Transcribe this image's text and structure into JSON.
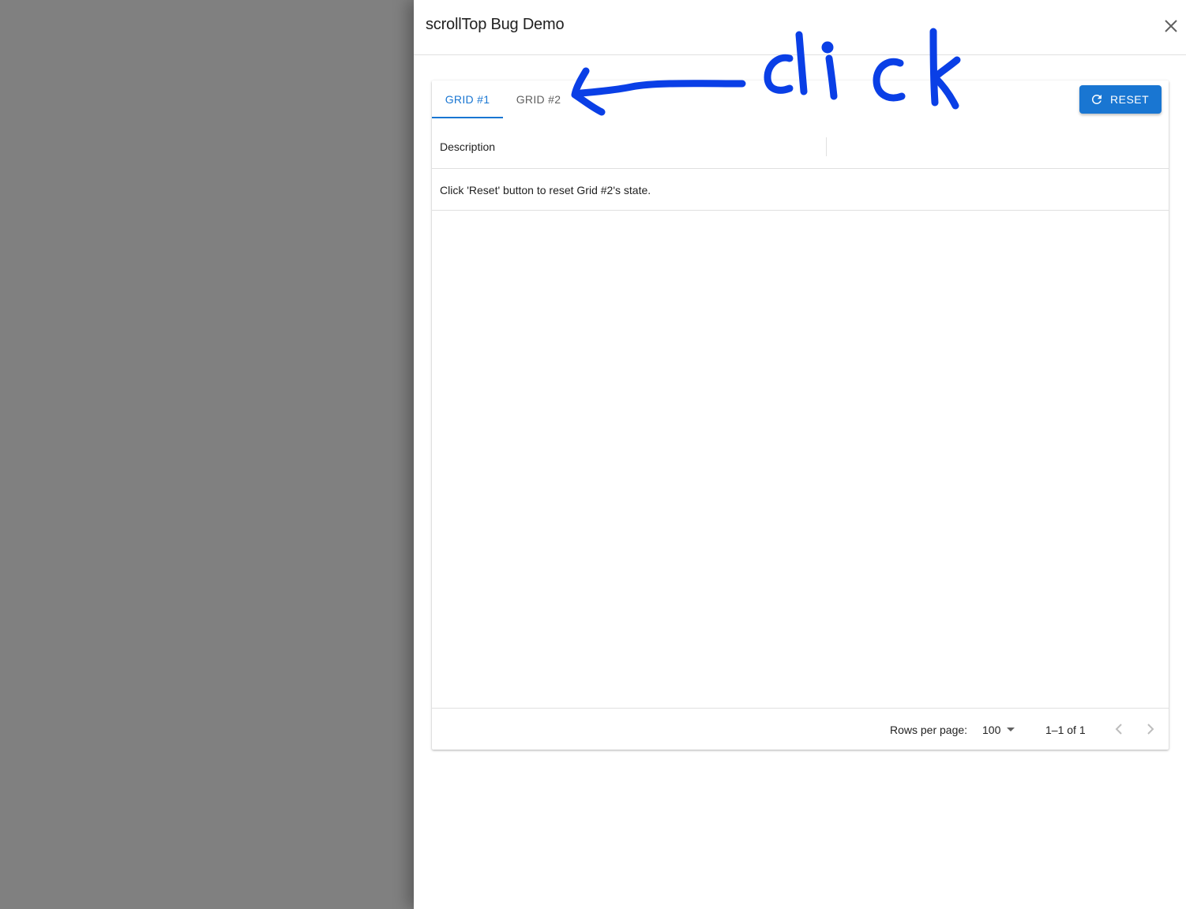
{
  "drawer": {
    "title": "scrollTop Bug Demo"
  },
  "tabs": [
    {
      "label": "GRID #1",
      "active": true
    },
    {
      "label": "GRID #2",
      "active": false
    }
  ],
  "toolbar": {
    "reset_label": "RESET"
  },
  "grid": {
    "columns": [
      "Description"
    ],
    "rows": [
      [
        "Click 'Reset' button to reset Grid #2's state."
      ]
    ]
  },
  "footer": {
    "rows_per_page_label": "Rows per page:",
    "rows_per_page_value": "100",
    "range_text": "1–1 of 1"
  },
  "annotation": {
    "handwritten_text": "click"
  },
  "colors": {
    "accent": "#1976d2",
    "backdrop": "#808080",
    "annotation": "#0a3fe6"
  },
  "icons": {
    "close": "close-icon",
    "reset": "refresh-icon",
    "rows_per_page": "caret-down-icon",
    "prev": "chevron-left-icon",
    "next": "chevron-right-icon"
  }
}
